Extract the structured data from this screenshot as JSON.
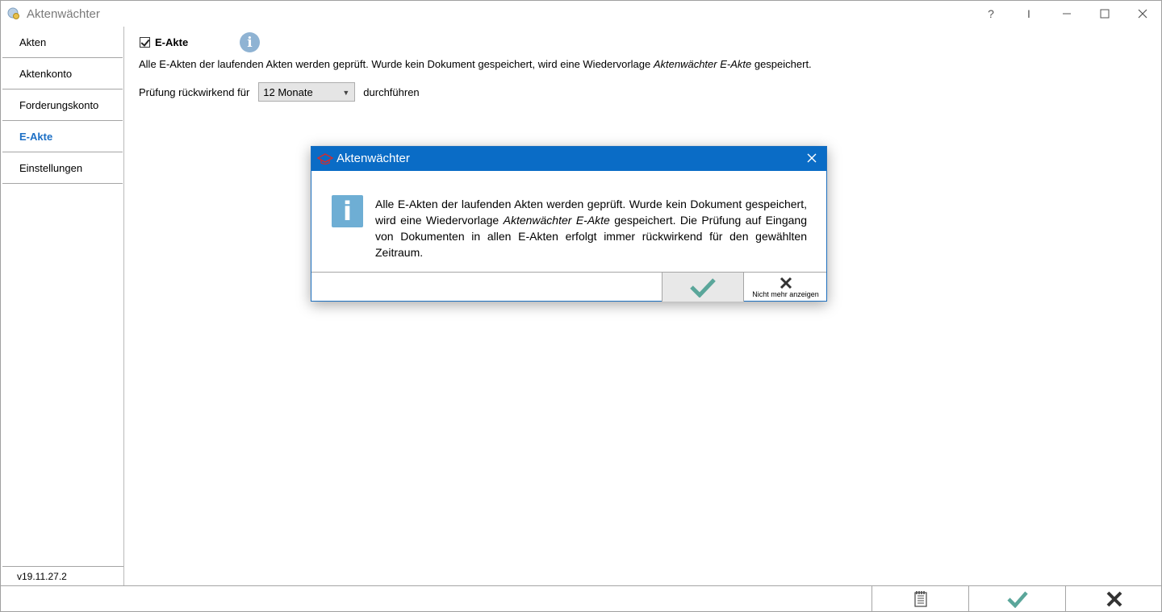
{
  "window": {
    "title": "Aktenwächter",
    "controls": {
      "help": "?",
      "pin": "I"
    }
  },
  "sidebar": {
    "items": [
      {
        "label": "Akten",
        "active": false
      },
      {
        "label": "Aktenkonto",
        "active": false
      },
      {
        "label": "Forderungskonto",
        "active": false
      },
      {
        "label": "E-Akte",
        "active": true
      },
      {
        "label": "Einstellungen",
        "active": false
      }
    ],
    "version": "v19.11.27.2"
  },
  "main": {
    "checkbox_label": "E-Akte",
    "checkbox_checked": true,
    "desc_prefix": "Alle E-Akten der laufenden Akten werden geprüft. Wurde kein Dokument gespeichert, wird eine Wiedervorlage ",
    "desc_italic": "Aktenwächter E-Akte",
    "desc_suffix": " gespeichert.",
    "period_prefix": "Prüfung rückwirkend für",
    "period_value": "12 Monate",
    "period_suffix": "durchführen"
  },
  "dialog": {
    "title": "Aktenwächter",
    "msg_part1": "Alle E-Akten der laufenden Akten werden geprüft. Wurde kein Dokument gespeichert, wird eine Wiedervorlage ",
    "msg_italic": "Aktenwächter E-Akte",
    "msg_part2": " gespeichert. Die Prüfung auf Eingang von Dokumenten in allen E-Akten erfolgt immer rückwirkend für den gewählten Zeitraum.",
    "dont_show_label": "Nicht mehr anzeigen"
  },
  "colors": {
    "accent": "#0a6cc6",
    "active_nav": "#1c6fc5",
    "check_green": "#5aa69a",
    "info_blue": "#6eaed4"
  }
}
